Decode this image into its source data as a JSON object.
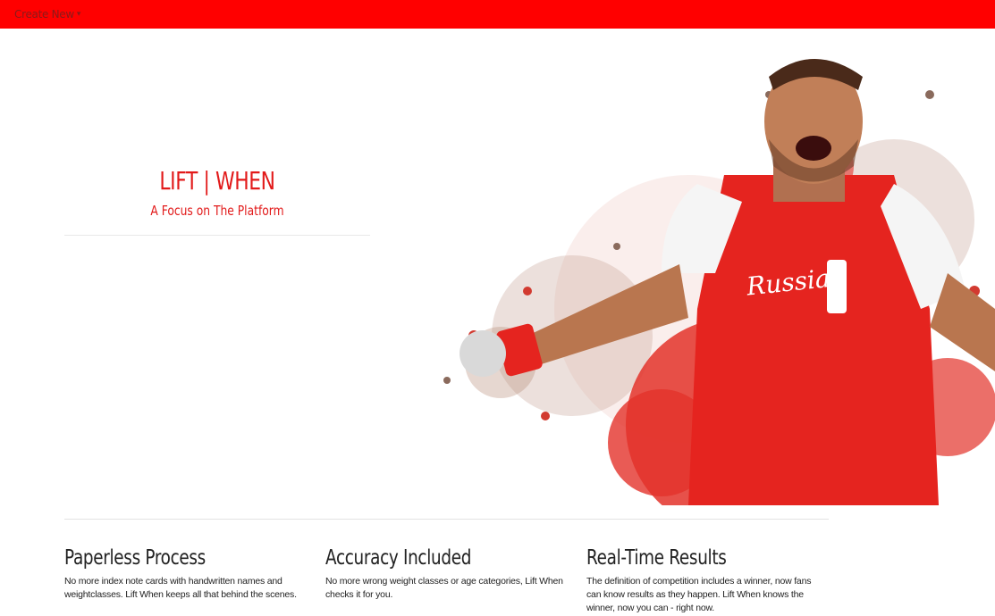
{
  "nav": {
    "dropdown_label": "Create New",
    "caret_icon": "caret-down-icon"
  },
  "hero": {
    "title": "LIFT | WHEN",
    "subtitle": "A Focus on The Platform",
    "image_jersey_text": "Russia"
  },
  "features": [
    {
      "title": "Paperless Process",
      "text": "No more index note cards with handwritten names and weightclasses. Lift When keeps all that behind the scenes."
    },
    {
      "title": "Accuracy Included",
      "text": "No more wrong weight classes or age categories, Lift When checks it for you."
    },
    {
      "title": "Real-Time Results",
      "text": "The definition of competition includes a winner, now fans can know results as they happen. Lift When knows the winner, now you can - right now."
    }
  ],
  "colors": {
    "brand_red": "#ff0000",
    "title_red": "#e21a1a",
    "text_dark": "#222222"
  }
}
